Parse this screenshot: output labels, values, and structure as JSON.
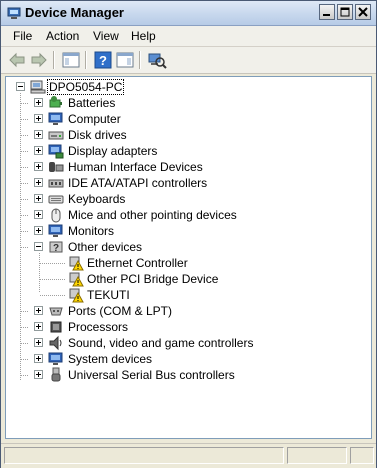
{
  "window": {
    "title": "Device Manager",
    "accent": "#c9d9ee",
    "caption_buttons": [
      "minimize-icon",
      "maximize-icon",
      "close-icon"
    ]
  },
  "menu": {
    "items": [
      {
        "label": "File"
      },
      {
        "label": "Action"
      },
      {
        "label": "View"
      },
      {
        "label": "Help"
      }
    ]
  },
  "toolbar": {
    "buttons": [
      "back-arrow-icon",
      "forward-arrow-icon",
      "console-tree-icon",
      "help-icon",
      "action-pane-icon",
      "scan-hardware-icon"
    ]
  },
  "tree": {
    "root": {
      "label": "DPO5054-PC",
      "icon": "computer-icon",
      "expanded": true
    },
    "categories": [
      {
        "label": "Batteries",
        "icon": "battery-icon",
        "expanded": false
      },
      {
        "label": "Computer",
        "icon": "monitor-icon",
        "expanded": false
      },
      {
        "label": "Disk drives",
        "icon": "disk-drive-icon",
        "expanded": false
      },
      {
        "label": "Display adapters",
        "icon": "display-adapter-icon",
        "expanded": false
      },
      {
        "label": "Human Interface Devices",
        "icon": "hid-icon",
        "expanded": false
      },
      {
        "label": "IDE ATA/ATAPI controllers",
        "icon": "ide-controller-icon",
        "expanded": false
      },
      {
        "label": "Keyboards",
        "icon": "keyboard-icon",
        "expanded": false
      },
      {
        "label": "Mice and other pointing devices",
        "icon": "mouse-icon",
        "expanded": false
      },
      {
        "label": "Monitors",
        "icon": "monitor-icon",
        "expanded": false
      },
      {
        "label": "Other devices",
        "icon": "other-devices-icon",
        "expanded": true,
        "children": [
          {
            "label": "Ethernet Controller",
            "icon": "unknown-device-warning-icon"
          },
          {
            "label": "Other PCI Bridge Device",
            "icon": "unknown-device-warning-icon"
          },
          {
            "label": "TEKUTI",
            "icon": "unknown-device-warning-icon"
          }
        ]
      },
      {
        "label": "Ports (COM & LPT)",
        "icon": "port-icon",
        "expanded": false
      },
      {
        "label": "Processors",
        "icon": "processor-icon",
        "expanded": false
      },
      {
        "label": "Sound, video and game controllers",
        "icon": "speaker-icon",
        "expanded": false
      },
      {
        "label": "System devices",
        "icon": "system-devices-icon",
        "expanded": false
      },
      {
        "label": "Universal Serial Bus controllers",
        "icon": "usb-icon",
        "expanded": false
      }
    ]
  },
  "statusbar": {
    "panes": [
      "",
      "",
      ""
    ]
  }
}
